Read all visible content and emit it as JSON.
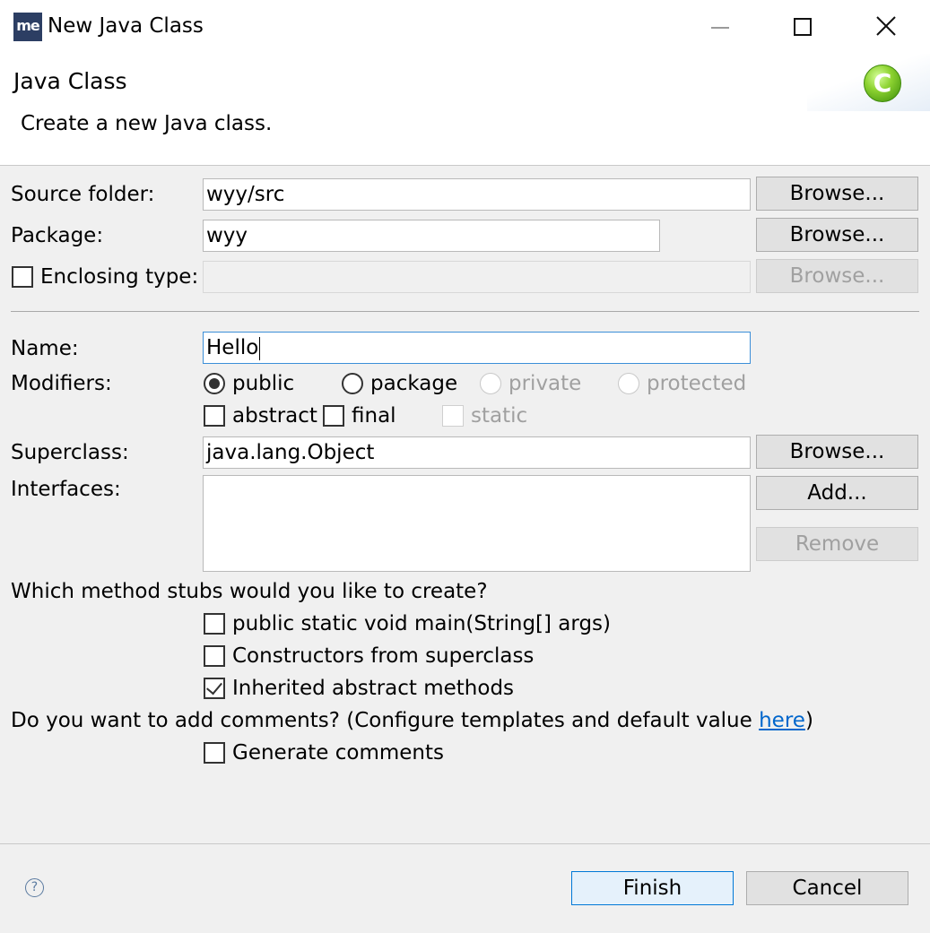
{
  "window": {
    "app_icon_text": "me",
    "title": "New Java Class",
    "controls": [
      "minimize-icon",
      "maximize-icon",
      "close-icon"
    ]
  },
  "banner": {
    "title": "Java Class",
    "description": "Create a new Java class.",
    "icon": "java-class-icon",
    "icon_letter": "C"
  },
  "form": {
    "source_folder": {
      "label": "Source folder:",
      "value": "wyy/src",
      "browse": "Browse..."
    },
    "package": {
      "label": "Package:",
      "value": "wyy",
      "browse": "Browse..."
    },
    "enclosing_type": {
      "label": "Enclosing type:",
      "checked": false,
      "value": "",
      "browse": "Browse..."
    },
    "name": {
      "label": "Name:",
      "value": "Hello"
    },
    "modifiers": {
      "label": "Modifiers:",
      "access": [
        {
          "label": "public",
          "selected": true,
          "enabled": true
        },
        {
          "label": "package",
          "selected": false,
          "enabled": true
        },
        {
          "label": "private",
          "selected": false,
          "enabled": false
        },
        {
          "label": "protected",
          "selected": false,
          "enabled": false
        }
      ],
      "flags": [
        {
          "label": "abstract",
          "checked": false,
          "enabled": true
        },
        {
          "label": "final",
          "checked": false,
          "enabled": true
        },
        {
          "label": "static",
          "checked": false,
          "enabled": false
        }
      ]
    },
    "superclass": {
      "label": "Superclass:",
      "value": "java.lang.Object",
      "browse": "Browse..."
    },
    "interfaces": {
      "label": "Interfaces:",
      "add": "Add...",
      "remove": "Remove",
      "items": []
    },
    "stubs": {
      "question": "Which method stubs would you like to create?",
      "options": [
        {
          "label": "public static void main(String[] args)",
          "checked": false
        },
        {
          "label": "Constructors from superclass",
          "checked": false
        },
        {
          "label": "Inherited abstract methods",
          "checked": true
        }
      ]
    },
    "comments": {
      "question_prefix": "Do you want to add comments? (Configure templates and default value ",
      "link": "here",
      "question_suffix": ")",
      "option": {
        "label": "Generate comments",
        "checked": false
      }
    }
  },
  "footer": {
    "help_icon": "help-icon",
    "help_symbol": "?",
    "finish": "Finish",
    "cancel": "Cancel"
  }
}
